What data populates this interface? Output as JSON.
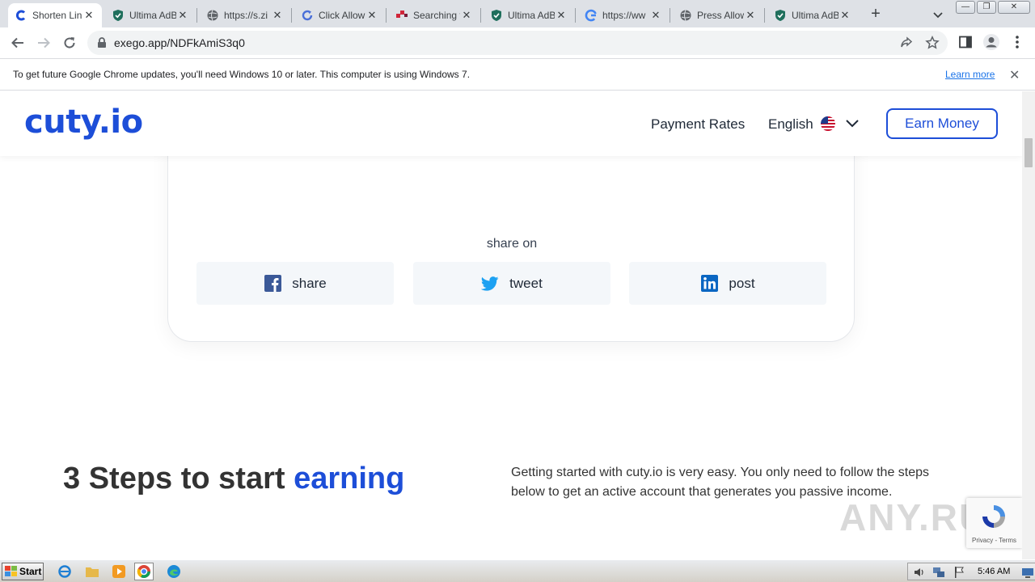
{
  "browser": {
    "tabs": [
      {
        "title": "Shorten Lin",
        "favicon": "cuty-favicon",
        "active": true
      },
      {
        "title": "Ultima AdBl",
        "favicon": "shield-favicon"
      },
      {
        "title": "https://s.zi",
        "favicon": "globe-favicon"
      },
      {
        "title": "Click Allow",
        "favicon": "refresh-favicon"
      },
      {
        "title": "Searching f",
        "favicon": "dots-favicon"
      },
      {
        "title": "Ultima AdBl",
        "favicon": "shield-favicon"
      },
      {
        "title": "https://ww",
        "favicon": "google-favicon"
      },
      {
        "title": "Press Allow",
        "favicon": "globe-favicon"
      },
      {
        "title": "Ultima AdBl",
        "favicon": "shield-favicon"
      }
    ],
    "url": "exego.app/NDFkAmiS3q0",
    "infobar": {
      "message": "To get future Google Chrome updates, you'll need Windows 10 or later. This computer is using Windows 7.",
      "learn_more": "Learn more"
    }
  },
  "site": {
    "logo": "cuty.io",
    "nav": {
      "payment_rates": "Payment Rates",
      "language": "English",
      "earn_money": "Earn Money"
    },
    "share": {
      "heading": "share on",
      "facebook": "share",
      "twitter": "tweet",
      "linkedin": "post"
    },
    "steps": {
      "title_prefix": "3 Steps to start ",
      "title_accent": "earning",
      "description": "Getting started with cuty.io is very easy. You only need to follow the steps below to get an active account that generates you passive income."
    },
    "recaptcha": {
      "links": "Privacy - Terms"
    }
  },
  "watermark": "ANY.RUN",
  "taskbar": {
    "start": "Start",
    "clock": "5:46 AM"
  },
  "colors": {
    "brand": "#1d4ed8",
    "facebook": "#3b5998",
    "twitter": "#1da1f2",
    "linkedin": "#0a66c2"
  }
}
